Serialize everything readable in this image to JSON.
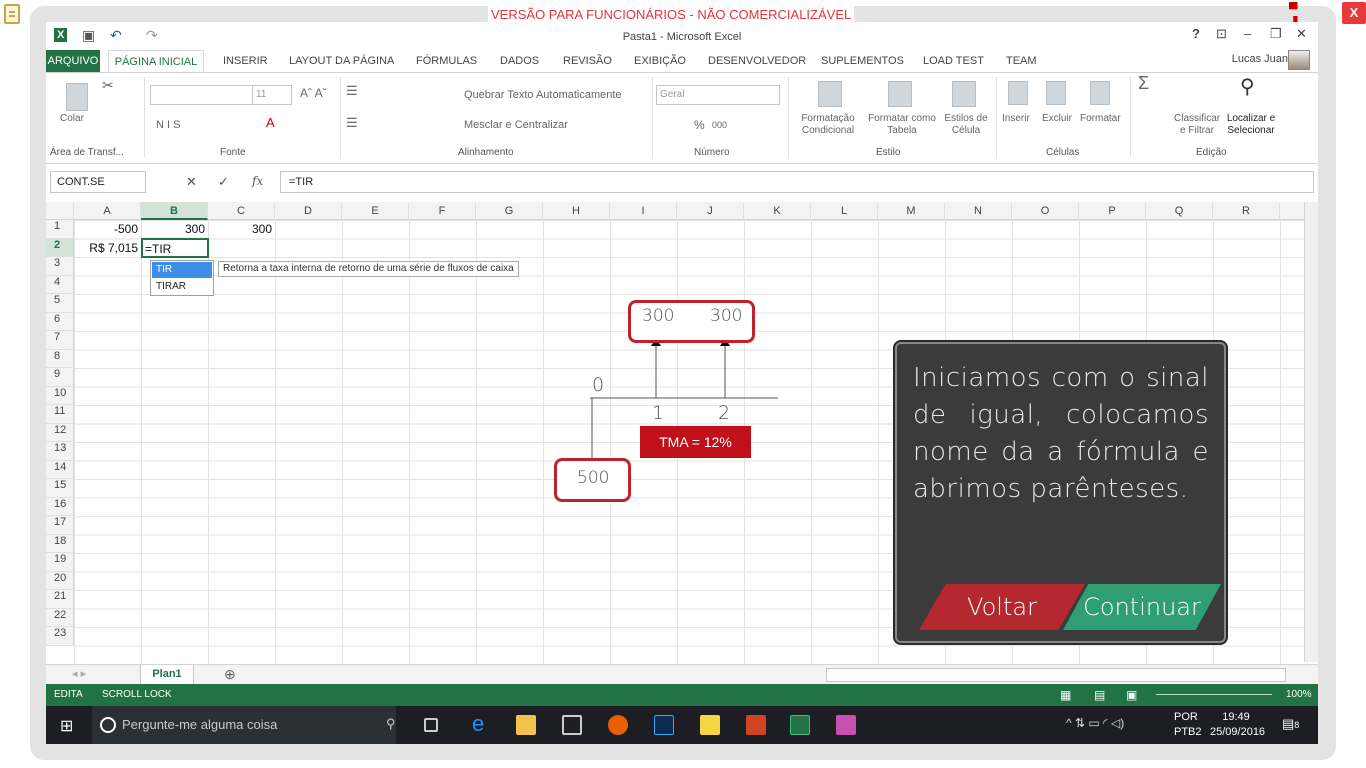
{
  "banner": "VERSÃO PARA FUNCIONÁRIOS - NÃO COMERCIALIZÁVEL",
  "close_label": "X",
  "window": {
    "title": "Pasta1 - Microsoft Excel",
    "help": "?",
    "user": "Lucas Juan"
  },
  "tabs": [
    "ARQUIVO",
    "PÁGINA INICIAL",
    "INSERIR",
    "LAYOUT DA PÁGINA",
    "FÓRMULAS",
    "DADOS",
    "REVISÃO",
    "EXIBIÇÃO",
    "DESENVOLVEDOR",
    "SUPLEMENTOS",
    "LOAD TEST",
    "TEAM"
  ],
  "ribbon": {
    "groups": [
      "Área de Transf...",
      "Fonte",
      "Alinhamento",
      "Número",
      "Estilo",
      "Células",
      "Edição"
    ],
    "colar": "Colar",
    "font_size": "11",
    "font_style_buttons": "N  I  S",
    "wrap_text": "Quebrar Texto Automaticamente",
    "merge": "Mesclar e Centralizar",
    "number_format": "Geral",
    "percent": "%",
    "thousands": "000",
    "cond_format": "Formatação Condicional",
    "format_table": "Formatar como Tabela",
    "cell_styles": "Estilos de Célula",
    "insert": "Inserir",
    "delete": "Excluir",
    "format": "Formatar",
    "sort": "Classificar e Filtrar",
    "find": "Localizar e Selecionar"
  },
  "formula_bar": {
    "name_box": "CONT.SE",
    "formula": "=TIR",
    "fx": "fx"
  },
  "columns": [
    "A",
    "B",
    "C",
    "D",
    "E",
    "F",
    "G",
    "H",
    "I",
    "J",
    "K",
    "L",
    "M",
    "N",
    "O",
    "P",
    "Q",
    "R"
  ],
  "rows": [
    "1",
    "2",
    "3",
    "4",
    "5",
    "6",
    "7",
    "8",
    "9",
    "10",
    "11",
    "12",
    "13",
    "14",
    "15",
    "16",
    "17",
    "18",
    "19",
    "20",
    "21",
    "22",
    "23"
  ],
  "cells": {
    "A1": "-500",
    "B1": "300",
    "C1": "300",
    "A2": "R$ 7,015",
    "B2": "=TIR"
  },
  "autocomplete": {
    "items": [
      "TIR",
      "TIRAR"
    ],
    "tooltip": "Retorna a taxa interna de retorno de uma série de fluxos de caixa"
  },
  "diagram": {
    "inflow_1": "300",
    "inflow_2": "300",
    "period_0": "0",
    "period_1": "1",
    "period_2": "2",
    "tma": "TMA = 12%",
    "outflow": "500"
  },
  "sheet": {
    "name": "Plan1",
    "add": "⊕"
  },
  "status": {
    "mode": "EDITA",
    "scroll_lock": "SCROLL LOCK",
    "zoom": "100%"
  },
  "taskbar": {
    "search_placeholder": "Pergunte-me alguma coisa",
    "lang": "POR",
    "layout": "PTB2",
    "time": "19:49",
    "date": "25/09/2016",
    "notifications": "8"
  },
  "overlay": {
    "text": "Iniciamos com o sinal de igual, colocamos nome da a fórmula e abrimos parênteses.",
    "back": "Voltar",
    "next": "Continuar"
  }
}
